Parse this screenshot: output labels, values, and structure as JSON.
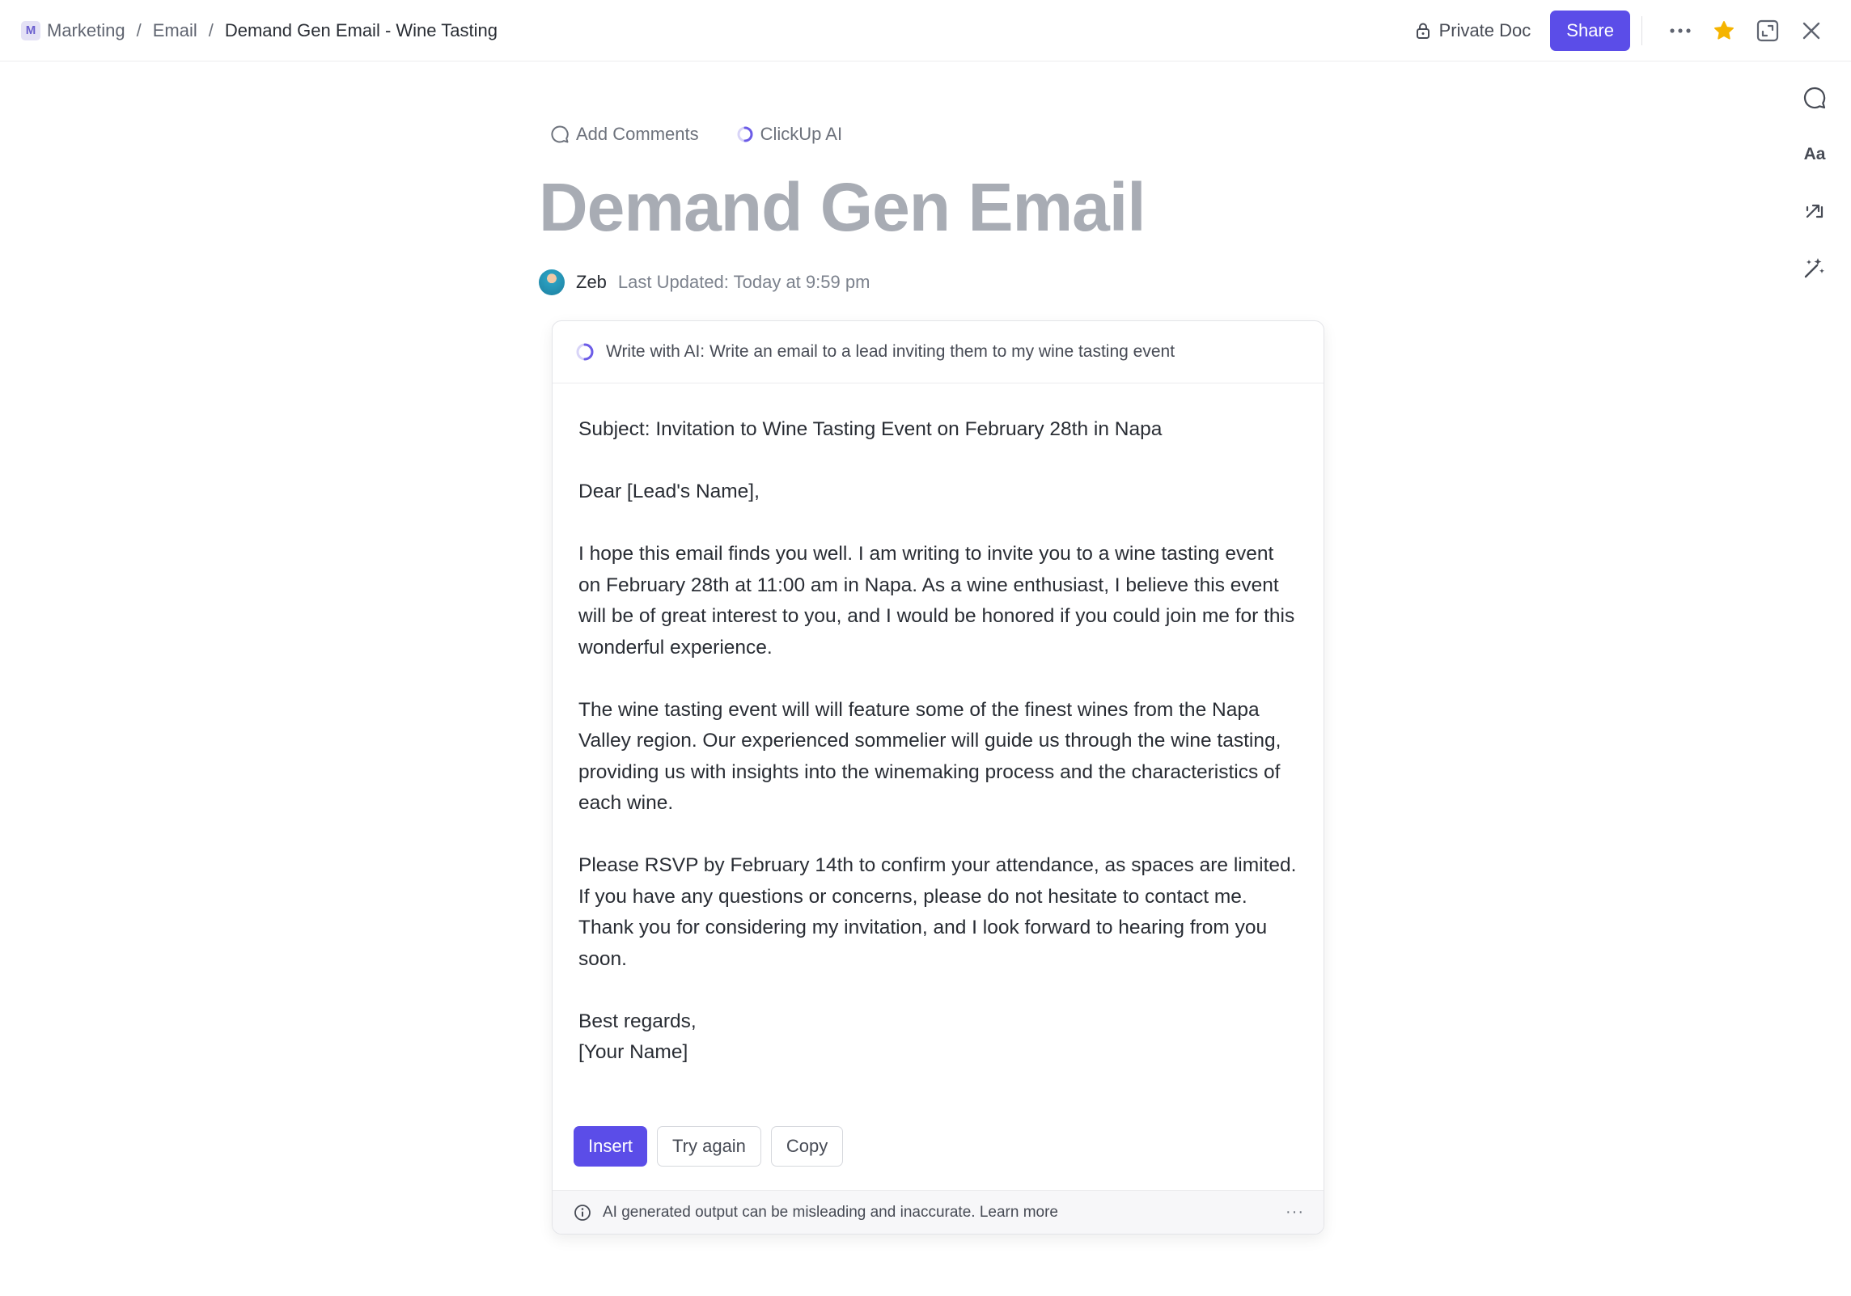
{
  "breadcrumb": {
    "space_initial": "M",
    "items": [
      "Marketing",
      "Email",
      "Demand Gen Email - Wine Tasting"
    ],
    "separator": "/"
  },
  "header": {
    "privacy_label": "Private Doc",
    "share_label": "Share",
    "more_icon": "ellipsis-icon",
    "favorite_icon": "star-icon",
    "expand_icon": "expand-icon",
    "close_icon": "close-icon"
  },
  "rail": {
    "items": [
      {
        "icon": "comment-icon"
      },
      {
        "icon": "text-format-icon",
        "label": "Aa"
      },
      {
        "icon": "relationships-icon"
      },
      {
        "icon": "ai-magic-icon"
      }
    ]
  },
  "doc": {
    "toolbar": {
      "add_comments": "Add Comments",
      "clickup_ai": "ClickUp AI"
    },
    "title": "Demand Gen Email",
    "author": "Zeb",
    "last_updated": "Last Updated: Today at 9:59 pm"
  },
  "ai": {
    "prompt": "Write with AI: Write an email to a lead inviting them to my wine tasting event",
    "output": {
      "subject": "Subject: Invitation to Wine Tasting Event on February 28th in Napa",
      "greeting": "Dear [Lead's Name],",
      "para1": "I hope this email finds you well. I am writing to invite you to a wine tasting event on February 28th at 11:00 am in Napa. As a wine enthusiast, I believe this event will be of great interest to you, and I would be honored if you could join me for this wonderful experience.",
      "para2": "The wine tasting event will  will feature some of the finest wines from the Napa Valley region. Our experienced sommelier will guide us through the wine tasting, providing us with insights into the winemaking process and the characteristics of each wine.",
      "para3": "Please RSVP by February 14th to confirm your attendance, as spaces are limited. If you have any questions or concerns, please do not hesitate to contact me.",
      "para4": "Thank you for considering my invitation, and I look forward to hearing from you soon.",
      "closing": "Best regards,",
      "signature": "[Your Name]"
    },
    "actions": {
      "insert": "Insert",
      "try_again": "Try again",
      "copy": "Copy"
    },
    "disclaimer": "AI generated output can be misleading and inaccurate. Learn more",
    "more": "···"
  },
  "colors": {
    "accent": "#5b4de8",
    "title_gray": "#a8acb4",
    "star": "#f5b400"
  }
}
